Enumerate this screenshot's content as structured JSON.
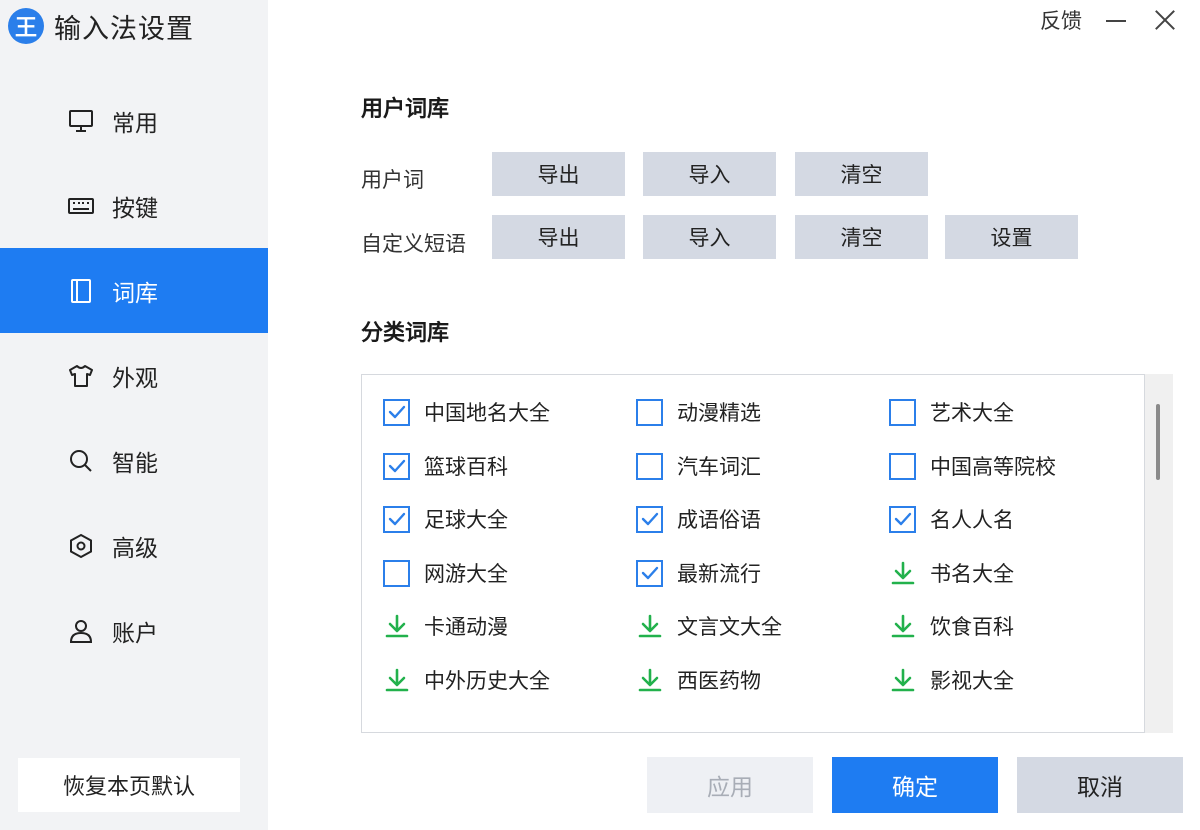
{
  "app": {
    "logo_glyph": "王",
    "title": "输入法设置"
  },
  "window": {
    "feedback_label": "反馈"
  },
  "colors": {
    "accent": "#1e7cf2",
    "button_gray": "#d4d9e3",
    "download_green": "#22b14c",
    "sidebar_bg": "#f2f3f5"
  },
  "sidebar": {
    "items": [
      {
        "label": "常用",
        "icon": "monitor-icon",
        "active": false
      },
      {
        "label": "按键",
        "icon": "keyboard-icon",
        "active": false
      },
      {
        "label": "词库",
        "icon": "book-icon",
        "active": true
      },
      {
        "label": "外观",
        "icon": "shirt-icon",
        "active": false
      },
      {
        "label": "智能",
        "icon": "search-icon",
        "active": false
      },
      {
        "label": "高级",
        "icon": "hexagon-icon",
        "active": false
      },
      {
        "label": "账户",
        "icon": "user-icon",
        "active": false
      }
    ],
    "restore_label": "恢复本页默认"
  },
  "user_dict": {
    "title": "用户词库",
    "rows": [
      {
        "label": "用户词",
        "buttons": [
          "导出",
          "导入",
          "清空"
        ]
      },
      {
        "label": "自定义短语",
        "buttons": [
          "导出",
          "导入",
          "清空",
          "设置"
        ]
      }
    ]
  },
  "category_dict": {
    "title": "分类词库",
    "columns": [
      [
        {
          "label": "中国地名大全",
          "state": "checked"
        },
        {
          "label": "篮球百科",
          "state": "checked"
        },
        {
          "label": "足球大全",
          "state": "checked"
        },
        {
          "label": "网游大全",
          "state": "unchecked"
        },
        {
          "label": "卡通动漫",
          "state": "download"
        },
        {
          "label": "中外历史大全",
          "state": "download"
        }
      ],
      [
        {
          "label": "动漫精选",
          "state": "unchecked"
        },
        {
          "label": "汽车词汇",
          "state": "unchecked"
        },
        {
          "label": "成语俗语",
          "state": "checked"
        },
        {
          "label": "最新流行",
          "state": "checked"
        },
        {
          "label": "文言文大全",
          "state": "download"
        },
        {
          "label": "西医药物",
          "state": "download"
        }
      ],
      [
        {
          "label": "艺术大全",
          "state": "unchecked"
        },
        {
          "label": "中国高等院校",
          "state": "unchecked"
        },
        {
          "label": "名人人名",
          "state": "checked"
        },
        {
          "label": "书名大全",
          "state": "download"
        },
        {
          "label": "饮食百科",
          "state": "download"
        },
        {
          "label": "影视大全",
          "state": "download"
        }
      ]
    ]
  },
  "footer": {
    "apply_label": "应用",
    "ok_label": "确定",
    "cancel_label": "取消"
  }
}
